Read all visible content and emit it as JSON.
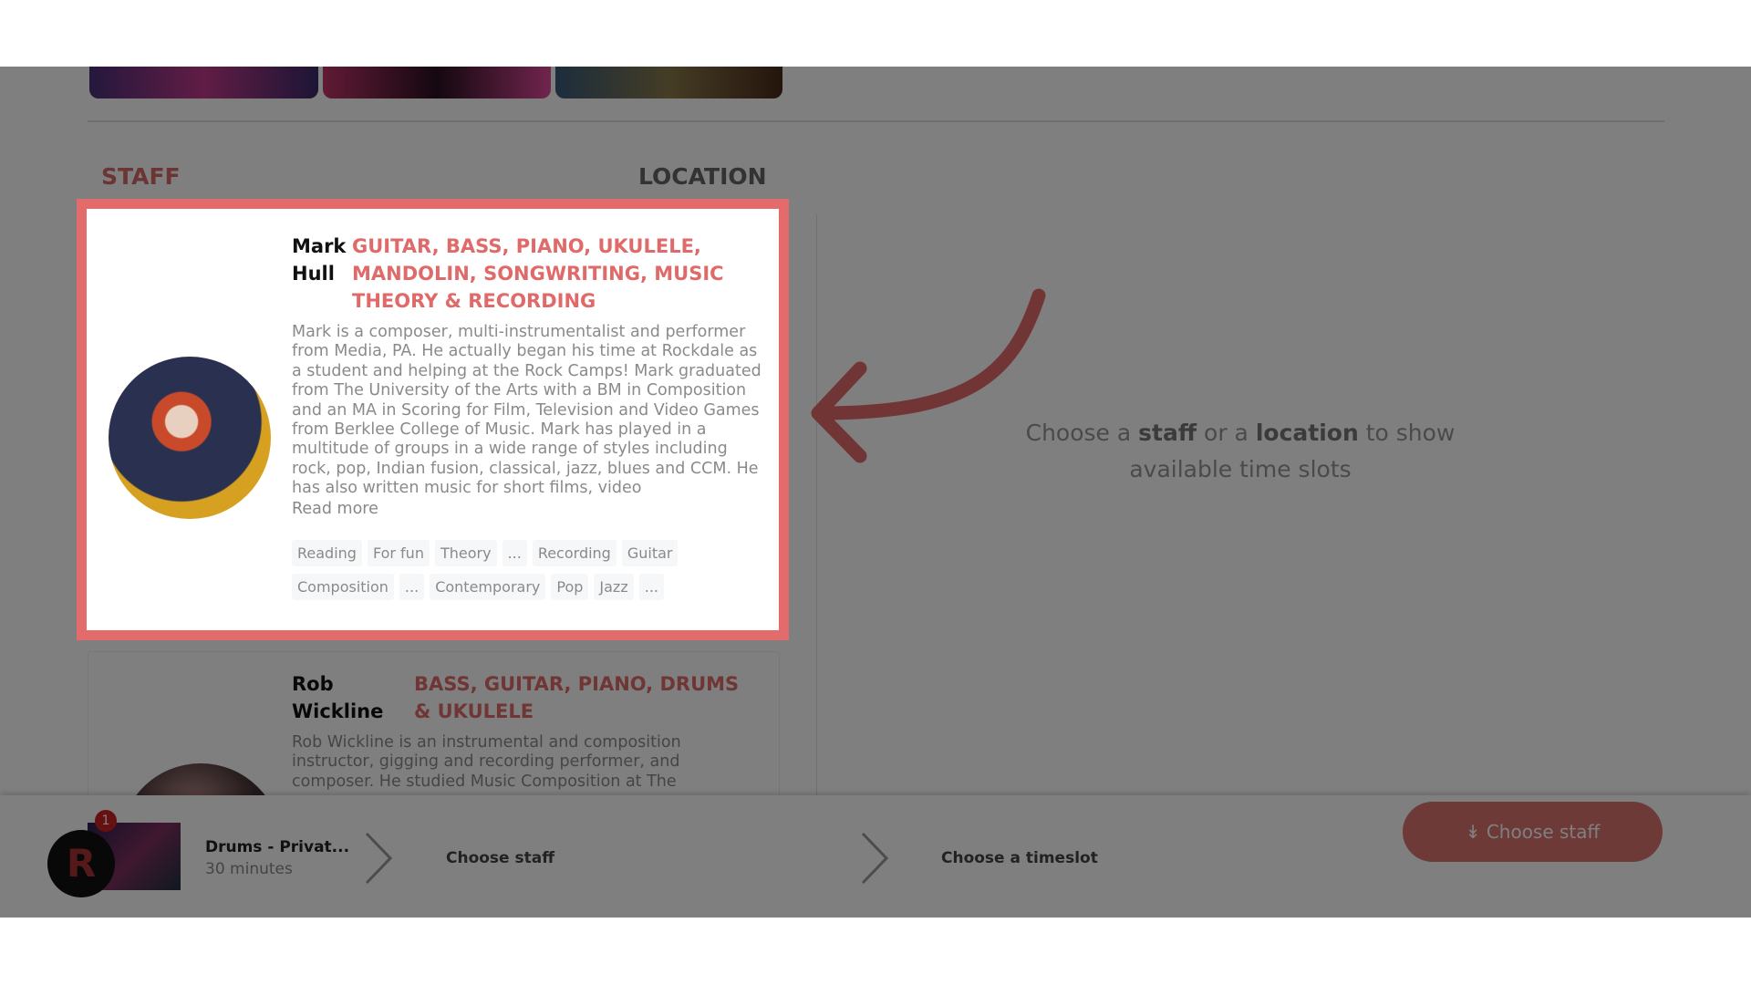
{
  "sections": {
    "staff_label": "STAFF",
    "location_label": "LOCATION"
  },
  "accent_color": "#e46b6b",
  "staff": [
    {
      "first": "Mark",
      "last": "Hull",
      "instruments": "Guitar, Bass, Piano, Ukulele, Mandolin, Songwriting, Music Theory & Recording",
      "bio": "Mark is a composer, multi-instrumentalist and performer from Media, PA. He actually began his time at Rockdale as a student and helping at the Rock Camps! Mark graduated from The University of the Arts with a BM in Composition and an MA in Scoring for Film, Television and Video Games from Berklee College of Music. Mark has played in a multitude of groups in a wide range of styles including rock, pop, Indian fusion, classical, jazz, blues and CCM. He has also written music for short films, video",
      "read_more": "Read more",
      "tags": [
        "Reading",
        "For fun",
        "Theory",
        "...",
        "Recording",
        "Guitar",
        "Composition",
        "...",
        "Contemporary",
        "Pop",
        "Jazz",
        "..."
      ]
    },
    {
      "first": "Rob",
      "last": "Wickline",
      "instruments": "Bass, Guitar, Piano, Drums & Ukulele",
      "bio": "Rob Wickline is an instrumental and composition instructor, gigging and recording performer, and composer. He studied Music Composition at The"
    }
  ],
  "message": {
    "pre": "Choose a ",
    "b1": "staff",
    "mid": " or a ",
    "b2": "location",
    "post": " to show available time slots"
  },
  "footer": {
    "badge": "1",
    "service": "Drums - Privat...",
    "duration": "30 minutes",
    "step1": "Choose staff",
    "step2": "Choose a timeslot",
    "button": "Choose staff"
  }
}
